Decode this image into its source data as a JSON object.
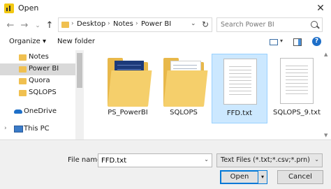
{
  "window": {
    "title": "Open",
    "close_glyph": "✕",
    "app_icon": "power-bi-icon"
  },
  "nav_buttons": {
    "back": "←",
    "forward": "→",
    "dropdown": "⌄",
    "up": "↑"
  },
  "address": {
    "crumbs": [
      "Desktop",
      "Notes",
      "Power BI"
    ],
    "separator": "›",
    "dropdown_glyph": "⌄",
    "refresh_glyph": "↻"
  },
  "search": {
    "placeholder": "Search Power BI"
  },
  "toolbar": {
    "organize": "Organize ▾",
    "new_folder": "New folder",
    "view_dropdown": "▾",
    "help": "?"
  },
  "nav_pane": {
    "items": [
      {
        "label": "Notes",
        "state": "normal"
      },
      {
        "label": "Power BI",
        "state": "dim-selected"
      },
      {
        "label": "Quora",
        "state": "normal"
      },
      {
        "label": "SQLOPS",
        "state": "normal"
      },
      {
        "label": "OneDrive",
        "icon": "onedrive-icon"
      },
      {
        "label": "This PC",
        "icon": "this-pc-icon",
        "chevron": "›"
      }
    ]
  },
  "files": [
    {
      "name": "PS_PowerBI",
      "type": "folder",
      "variant": "dark-page",
      "selected": false
    },
    {
      "name": "SQLOPS",
      "type": "folder",
      "variant": "white-page",
      "selected": false
    },
    {
      "name": "FFD.txt",
      "type": "text-file",
      "selected": true
    },
    {
      "name": "SQLOPS_9.txt",
      "type": "text-file",
      "selected": false
    }
  ],
  "scroll_glyphs": {
    "up": "▲",
    "down": "▼"
  },
  "footer": {
    "file_name_label": "File name:",
    "file_name_value": "FFD.txt",
    "file_type": "Text Files (*.txt;*.csv;*.prn)",
    "dropdown_glyph": "⌄",
    "open_label": "Open",
    "open_split_glyph": "▾",
    "cancel_label": "Cancel"
  },
  "colors": {
    "selection": "#cce8ff",
    "accent": "#0078d7",
    "folder": "#e8b84a"
  }
}
